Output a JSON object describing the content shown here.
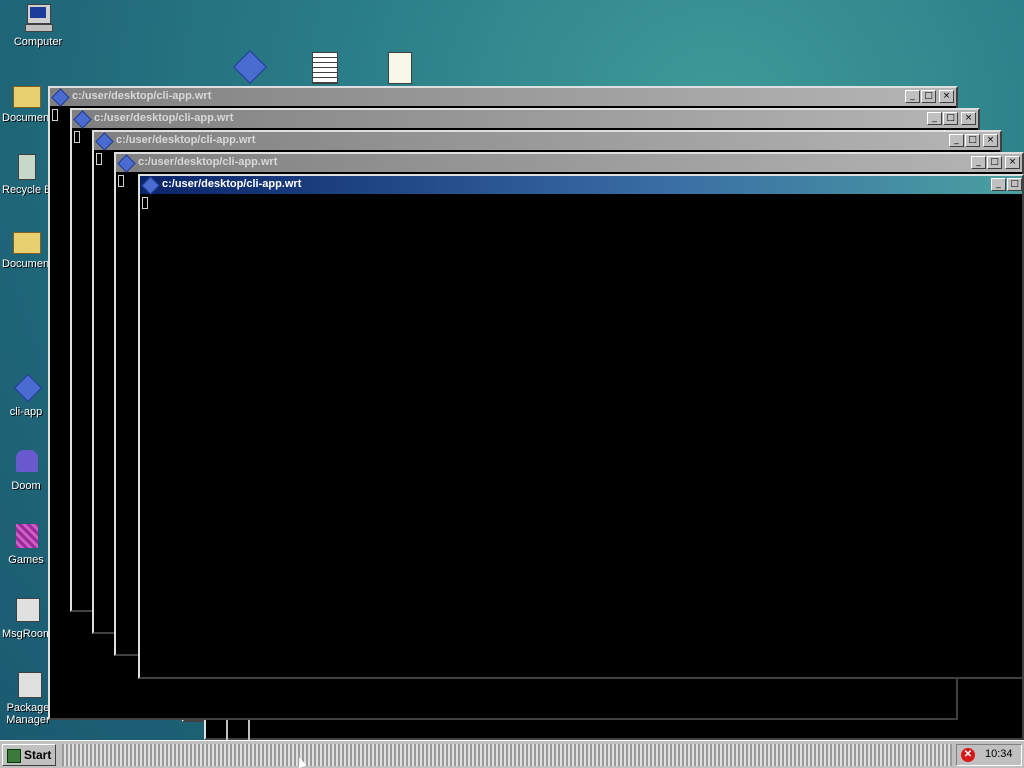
{
  "desktop": {
    "icons": [
      {
        "id": "computer",
        "label": "Computer"
      },
      {
        "id": "documents",
        "label": "Documents"
      },
      {
        "id": "recycle",
        "label": "Recycle Bin"
      },
      {
        "id": "doc2",
        "label": "Documents"
      },
      {
        "id": "cliapp",
        "label": "cli-app"
      },
      {
        "id": "doom",
        "label": "Doom"
      },
      {
        "id": "games",
        "label": "Games"
      },
      {
        "id": "msgr",
        "label": "MsgRoom"
      },
      {
        "id": "pkg",
        "label": "Package Manager"
      }
    ]
  },
  "windows": [
    {
      "title": "c:/user/desktop/cli-app.wrt"
    },
    {
      "title": "c:/user/desktop/cli-app.wrt"
    },
    {
      "title": "c:/user/desktop/cli-app.wrt"
    },
    {
      "title": "c:/user/desktop/cli-app.wrt"
    },
    {
      "title": "c:/user/desktop/cli-app.wrt"
    }
  ],
  "buttons": {
    "minimize": "_",
    "maximize": "□",
    "close": "×"
  },
  "taskbar": {
    "start_label": "Start",
    "clock": "10:34"
  },
  "colors": {
    "active_title": "#0a246a",
    "inactive_title": "#808080",
    "taskbar": "#c0c0c0"
  }
}
